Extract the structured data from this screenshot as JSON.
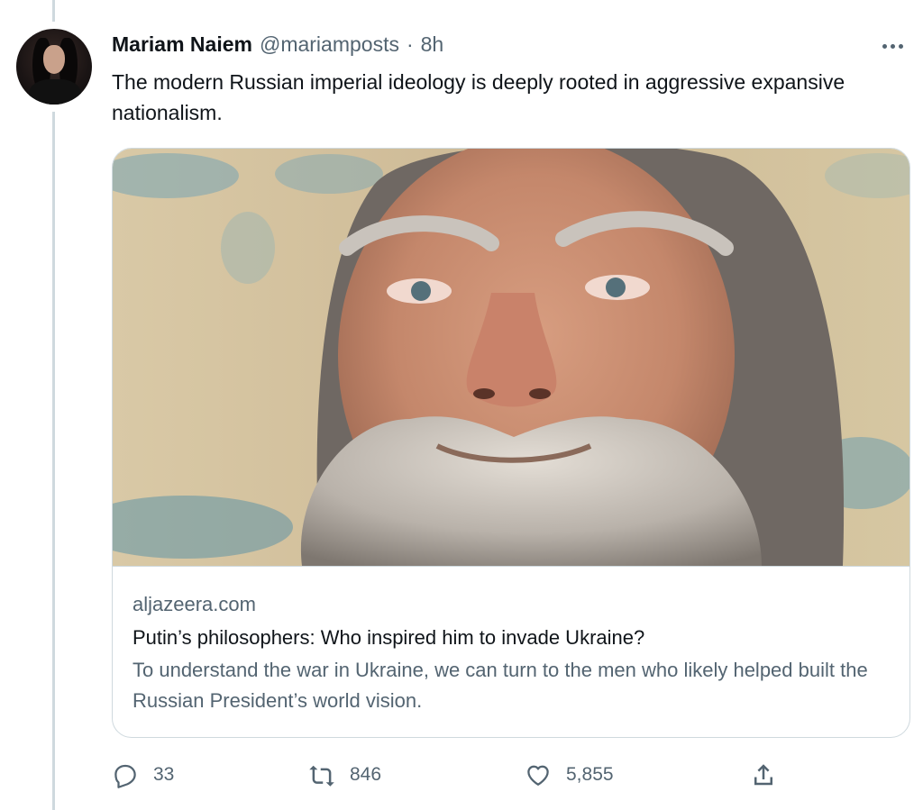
{
  "tweet": {
    "author_name": "Mariam Naiem",
    "author_handle": "@mariamposts",
    "separator": "·",
    "time": "8h",
    "text": "The modern Russian imperial ideology is deeply rooted in aggressive expansive nationalism."
  },
  "card": {
    "domain": "aljazeera.com",
    "title": "Putin’s philosophers: Who inspired him to invade Ukraine?",
    "description": "To understand the war in Ukraine, we can turn to the men who likely helped built the Russian President’s world vision."
  },
  "actions": {
    "reply_count": "33",
    "retweet_count": "846",
    "like_count": "5,855",
    "icons": [
      "reply-icon",
      "retweet-icon",
      "like-icon",
      "share-icon"
    ]
  },
  "colors": {
    "text_primary": "#0f1419",
    "text_secondary": "#536471",
    "border": "#cfd9de"
  }
}
